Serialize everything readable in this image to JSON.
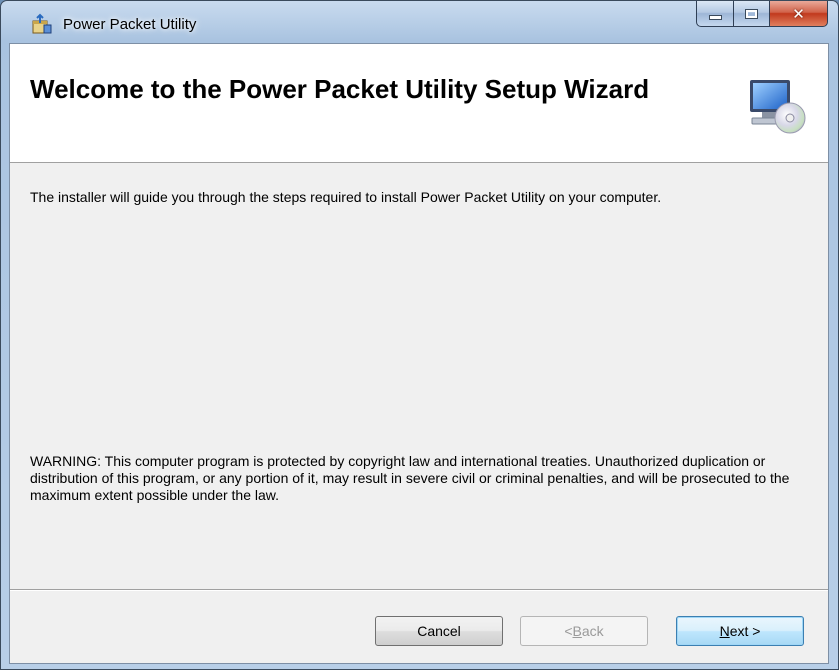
{
  "window": {
    "title": "Power Packet Utility",
    "icon": "installer-package-icon"
  },
  "banner": {
    "title": "Welcome to the Power Packet Utility Setup Wizard",
    "icon": "computer-cd-icon"
  },
  "body": {
    "intro": "The installer will guide you through the steps required to install Power Packet Utility on your computer.",
    "warning": "WARNING: This computer program is protected by copyright law and international treaties. Unauthorized duplication or distribution of this program, or any portion of it, may result in severe civil or criminal penalties, and will be prosecuted to the maximum extent possible under the law."
  },
  "buttons": {
    "cancel": "Cancel",
    "back_prefix": "< ",
    "back_accel": "B",
    "back_rest": "ack",
    "next_accel": "N",
    "next_rest": "ext >"
  },
  "colors": {
    "next_border": "#3c7fb1",
    "close_button": "#c1391d"
  }
}
